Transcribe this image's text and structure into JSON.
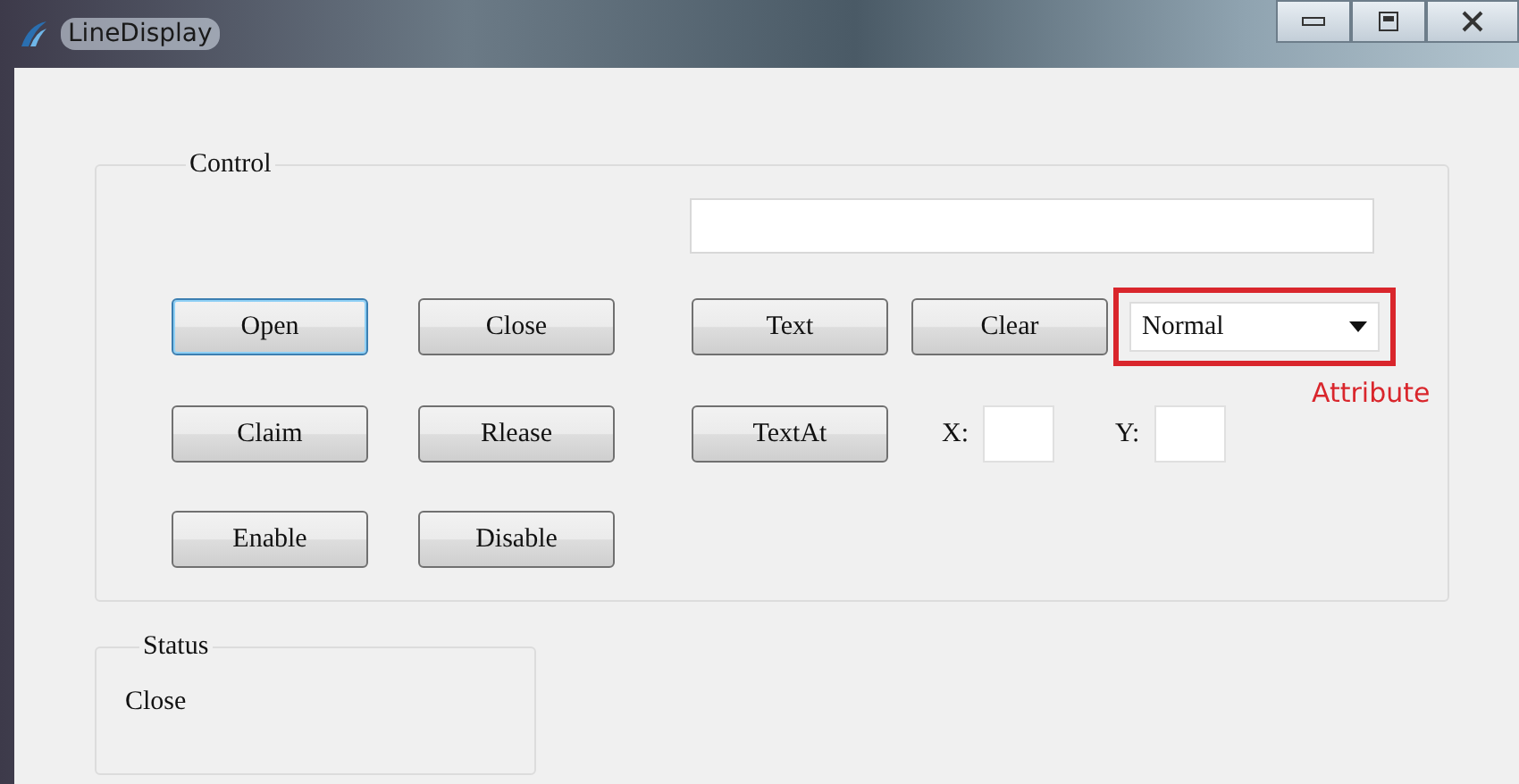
{
  "window": {
    "title": "LineDisplay"
  },
  "control_group": {
    "label": "Control",
    "rows": [
      [
        {
          "label": "Open",
          "focused": true
        },
        {
          "label": "Close",
          "focused": false
        }
      ],
      [
        {
          "label": "Claim",
          "focused": false
        },
        {
          "label": "Rlease",
          "focused": false
        }
      ],
      [
        {
          "label": "Enable",
          "focused": false
        },
        {
          "label": "Disable",
          "focused": false
        }
      ]
    ],
    "text_buttons": [
      {
        "label": "Text",
        "focused": false
      },
      {
        "label": "Clear",
        "focused": false
      }
    ],
    "attribute_combo": {
      "value": "Normal",
      "annotation": "Attribute"
    },
    "textat_button": {
      "label": "TextAt",
      "focused": false
    },
    "x_label": "X:",
    "y_label": "Y:"
  },
  "status_group": {
    "label": "Status",
    "value": "Close"
  }
}
